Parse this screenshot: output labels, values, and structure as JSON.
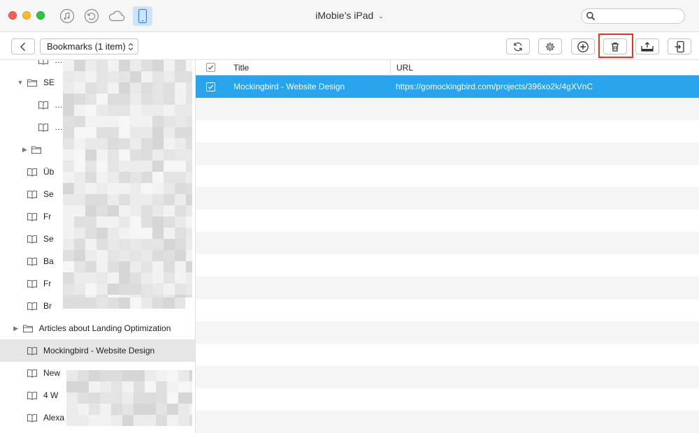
{
  "window": {
    "device_title": "iMobie’s iPad",
    "search": {
      "placeholder": "",
      "value": ""
    },
    "modes": [
      "music-icon",
      "backup-restore-icon",
      "icloud-icon",
      "ipad-device-icon"
    ]
  },
  "toolbar": {
    "breadcrumb_label": "Bookmarks (1 item)",
    "actions": [
      "refresh-icon",
      "settings-icon",
      "add-icon",
      "delete-icon",
      "export-to-computer-icon",
      "send-to-device-icon"
    ],
    "highlighted_action": "delete"
  },
  "sidebar": {
    "items": [
      {
        "label": "…",
        "type": "bookmark",
        "indent": 2,
        "expander": ""
      },
      {
        "label": "SE",
        "type": "folder",
        "indent": 1,
        "expander": "▼"
      },
      {
        "label": "…",
        "type": "bookmark",
        "indent": 2,
        "expander": ""
      },
      {
        "label": "…",
        "type": "bookmark",
        "indent": 2,
        "expander": ""
      },
      {
        "label": "",
        "type": "folder",
        "indent": 1.4,
        "expander": "▶"
      },
      {
        "label": "Üb",
        "type": "bookmark",
        "indent": 1,
        "expander": ""
      },
      {
        "label": "Se",
        "type": "bookmark",
        "indent": 1,
        "expander": ""
      },
      {
        "label": "Fr",
        "type": "bookmark",
        "indent": 1,
        "expander": ""
      },
      {
        "label": "Se",
        "type": "bookmark",
        "indent": 1,
        "expander": ""
      },
      {
        "label": "Ba",
        "type": "bookmark",
        "indent": 1,
        "expander": ""
      },
      {
        "label": "Fr",
        "type": "bookmark",
        "indent": 1,
        "expander": ""
      },
      {
        "label": "Br",
        "type": "bookmark",
        "indent": 1,
        "expander": ""
      },
      {
        "label": "Articles about Landing Optimization",
        "type": "folder",
        "indent": 0.6,
        "expander": "▶"
      },
      {
        "label": "Mockingbird - Website Design",
        "type": "bookmark",
        "indent": 1,
        "expander": "",
        "selected": true
      },
      {
        "label": "New",
        "type": "bookmark",
        "indent": 1,
        "expander": ""
      },
      {
        "label": "4 W",
        "type": "bookmark",
        "indent": 1,
        "expander": ""
      },
      {
        "label": "Alexa - Top Sites in United States",
        "type": "bookmark",
        "indent": 1,
        "expander": ""
      }
    ]
  },
  "table": {
    "columns": {
      "title": "Title",
      "url": "URL"
    },
    "rows": [
      {
        "title": "Mockingbird - Website Design",
        "url": "https://gomockingbird.com/projects/396xo2k/4gXVnC",
        "checked": true,
        "selected": true
      }
    ]
  },
  "colors": {
    "selection": "#28a4ec",
    "highlight_box": "#e8321f",
    "sidebar_selected": "#e6e6e6",
    "active_mode": "#cfe4f8"
  }
}
